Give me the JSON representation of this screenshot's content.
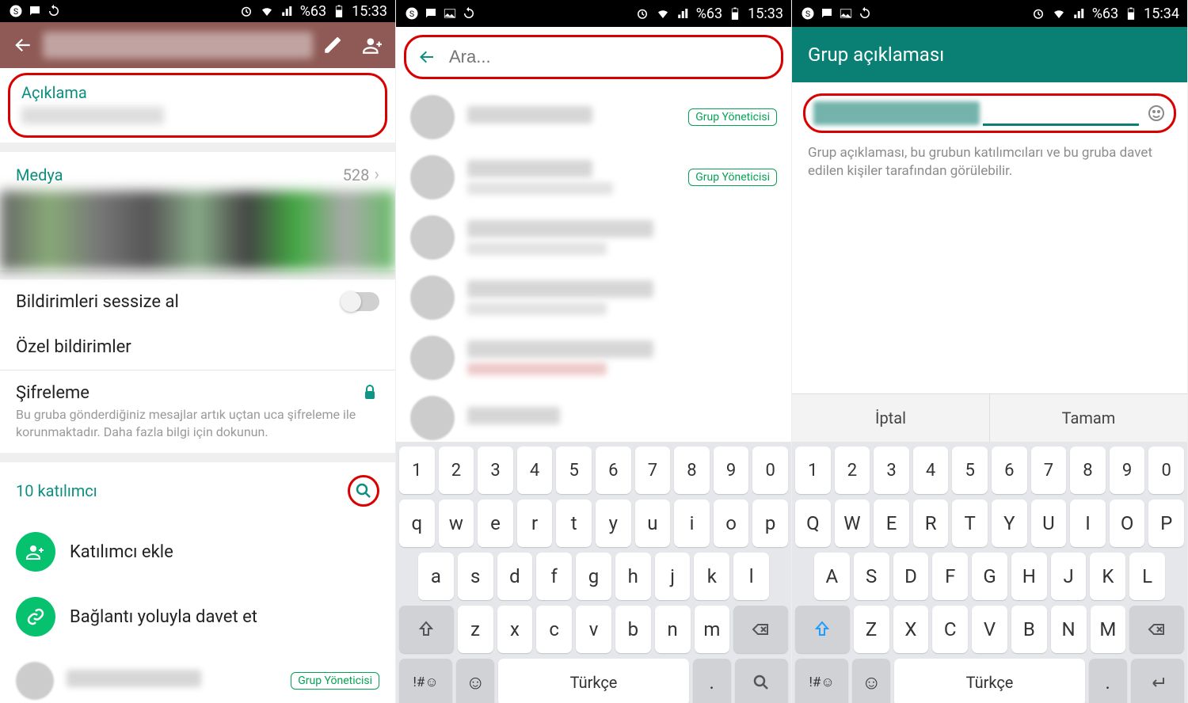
{
  "status": {
    "battery": "%63",
    "time1": "15:33",
    "time2": "15:33",
    "time3": "15:34"
  },
  "p1": {
    "desc_label": "Açıklama",
    "media_label": "Medya",
    "media_count": "528",
    "mute": "Bildirimleri sessize al",
    "custom_notif": "Özel bildirimler",
    "encryption": "Şifreleme",
    "encryption_sub": "Bu gruba gönderdiğiniz mesajlar artık uçtan uca şifreleme ile korunmaktadır. Daha fazla bilgi için dokunun.",
    "participants": "10 katılımcı",
    "add_participant": "Katılımcı ekle",
    "invite_link": "Bağlantı yoluyla davet et",
    "admin": "Grup Yöneticisi"
  },
  "p2": {
    "search_placeholder": "Ara...",
    "admin": "Grup Yöneticisi"
  },
  "p3": {
    "title": "Grup açıklaması",
    "help": "Grup açıklaması, bu grubun katılımcıları ve bu gruba davet edilen kişiler tarafından görülebilir.",
    "cancel": "İptal",
    "ok": "Tamam"
  },
  "kbd": {
    "row1": [
      "1",
      "2",
      "3",
      "4",
      "5",
      "6",
      "7",
      "8",
      "9",
      "0"
    ],
    "row2_lower": [
      "q",
      "w",
      "e",
      "r",
      "t",
      "y",
      "u",
      "i",
      "o",
      "p"
    ],
    "row2_upper": [
      "Q",
      "W",
      "E",
      "R",
      "T",
      "Y",
      "U",
      "I",
      "O",
      "P"
    ],
    "row3_lower": [
      "a",
      "s",
      "d",
      "f",
      "g",
      "h",
      "j",
      "k",
      "l"
    ],
    "row3_upper": [
      "A",
      "S",
      "D",
      "F",
      "G",
      "H",
      "J",
      "K",
      "L"
    ],
    "row4_lower": [
      "z",
      "x",
      "c",
      "v",
      "b",
      "n",
      "m"
    ],
    "row4_upper": [
      "Z",
      "X",
      "C",
      "V",
      "B",
      "N",
      "M"
    ],
    "sym": "!#☺",
    "lang": "Türkçe",
    "dot": "."
  }
}
